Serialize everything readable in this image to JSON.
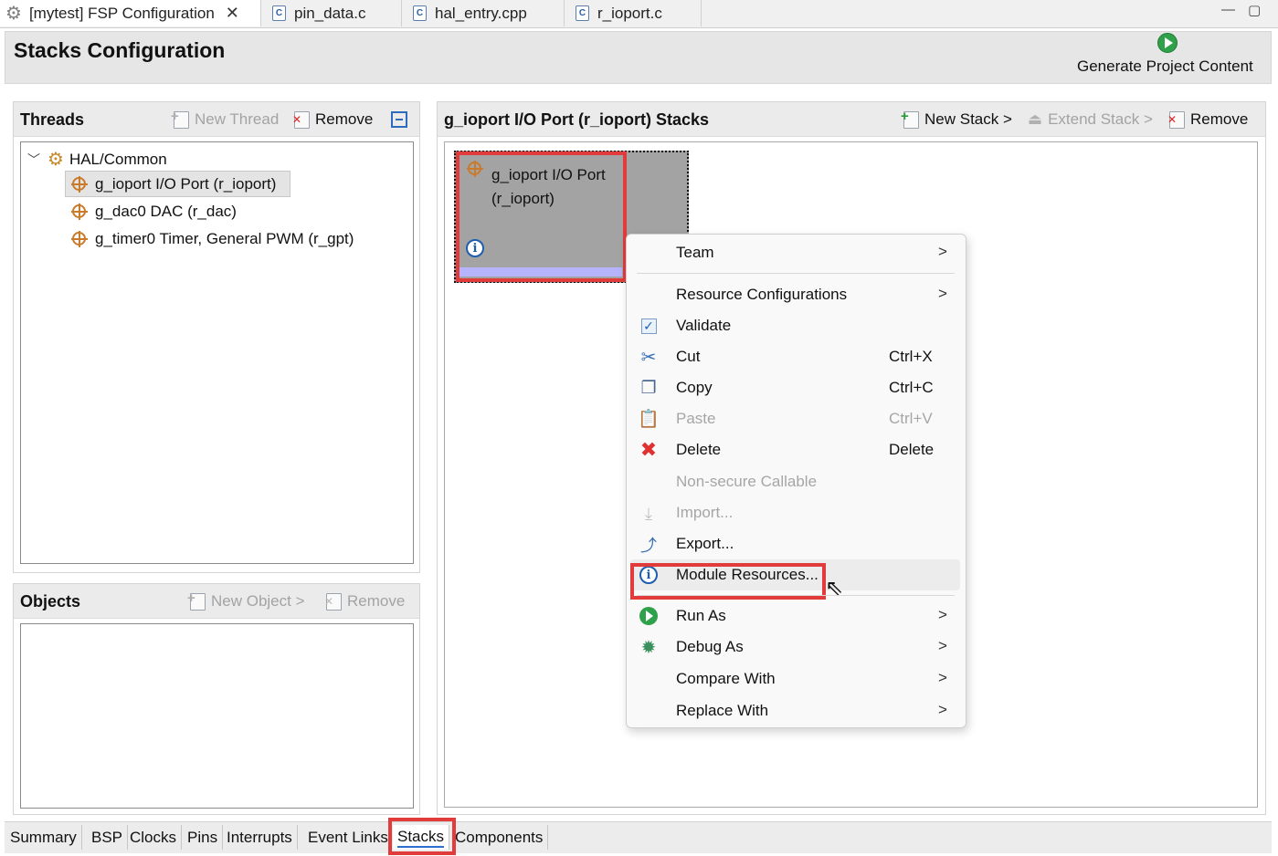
{
  "editor_tabs": [
    {
      "label": "[mytest] FSP Configuration",
      "icon": "gear-icon",
      "active": true
    },
    {
      "label": "pin_data.c",
      "icon": "c-file-icon"
    },
    {
      "label": "hal_entry.cpp",
      "icon": "c-file-icon"
    },
    {
      "label": "r_ioport.c",
      "icon": "c-file-icon"
    }
  ],
  "window_controls": {
    "minimize": "—",
    "restore": "▢"
  },
  "header": {
    "title": "Stacks Configuration",
    "generate_label": "Generate Project Content"
  },
  "threads_panel": {
    "title": "Threads",
    "new_thread": "New Thread",
    "remove": "Remove",
    "tree": {
      "root": "HAL/Common",
      "items": [
        "g_ioport I/O Port (r_ioport)",
        "g_dac0 DAC (r_dac)",
        "g_timer0 Timer, General PWM (r_gpt)"
      ]
    }
  },
  "objects_panel": {
    "title": "Objects",
    "new_object": "New Object >",
    "remove": "Remove"
  },
  "stacks_panel": {
    "title": "g_ioport I/O Port (r_ioport) Stacks",
    "new_stack": "New Stack >",
    "extend_stack": "Extend Stack >",
    "remove": "Remove",
    "block_line1": "g_ioport I/O Port",
    "block_line2": "(r_ioport)"
  },
  "context_menu": {
    "team": "Team",
    "resource_configurations": "Resource Configurations",
    "validate": "Validate",
    "cut": "Cut",
    "cut_shortcut": "Ctrl+X",
    "copy": "Copy",
    "copy_shortcut": "Ctrl+C",
    "paste": "Paste",
    "paste_shortcut": "Ctrl+V",
    "delete": "Delete",
    "delete_shortcut": "Delete",
    "non_secure": "Non-secure Callable",
    "import": "Import...",
    "export": "Export...",
    "module_resources": "Module Resources...",
    "run_as": "Run As",
    "debug_as": "Debug As",
    "compare_with": "Compare With",
    "replace_with": "Replace With",
    "arrow": ">"
  },
  "bottom_tabs": [
    "Summary",
    "BSP",
    "Clocks",
    "Pins",
    "Interrupts",
    "Event Links",
    "Stacks",
    "Components"
  ],
  "active_bottom_tab": "Stacks",
  "colors": {
    "highlight_box": "#e23b3b",
    "stack_bar": "#b6b3ff",
    "stack_block": "#a3a3a3"
  }
}
